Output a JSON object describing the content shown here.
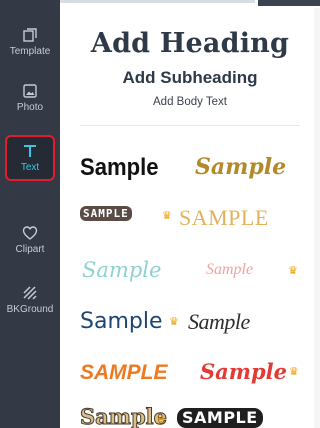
{
  "sidebar": {
    "items": [
      {
        "label": "Template",
        "icon": "template-icon",
        "active": false
      },
      {
        "label": "Photo",
        "icon": "photo-icon",
        "active": false
      },
      {
        "label": "Text",
        "icon": "text-icon",
        "active": true
      },
      {
        "label": "Clipart",
        "icon": "heart-icon",
        "active": false
      },
      {
        "label": "BKGround",
        "icon": "background-hatch-icon",
        "active": false
      }
    ],
    "active_color": "#3fc3e6",
    "active_border_color": "#e11d2c"
  },
  "panel": {
    "heading": "Add Heading",
    "subheading": "Add Subheading",
    "body": "Add Body Text"
  },
  "samples": [
    {
      "text": "Sample",
      "premium": false,
      "color": "#111111"
    },
    {
      "text": "Sample",
      "premium": false,
      "color": "#b28a2a"
    },
    {
      "text": "SAMPLE",
      "premium": true,
      "color": "#5a4b44"
    },
    {
      "text": "SAMPLE",
      "premium": false,
      "color": "#e3b15c"
    },
    {
      "text": "Sample",
      "premium": false,
      "color": "#8fd0d1"
    },
    {
      "text": "Sample",
      "premium": true,
      "color": "#f2a2a2"
    },
    {
      "text": "Sample",
      "premium": true,
      "color": "#1d4673"
    },
    {
      "text": "Sample",
      "premium": false,
      "color": "#2e2e2e"
    },
    {
      "text": "SAMPLE",
      "premium": false,
      "color": "#ec7a22"
    },
    {
      "text": "Sample",
      "premium": true,
      "color": "#e23a34"
    },
    {
      "text": "Sample",
      "premium": true,
      "color": "#d9c08a"
    },
    {
      "text": "SAMPLE",
      "premium": false,
      "color": "#1f1f1f"
    }
  ],
  "crown_icon": "crown-icon",
  "crown_color": "#f0a000"
}
